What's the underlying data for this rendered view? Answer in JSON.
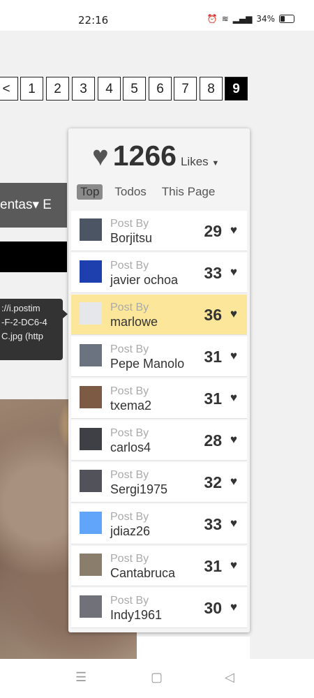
{
  "status_bar": {
    "time": "22:16",
    "battery": "34%"
  },
  "pagination": {
    "prev": "<",
    "pages": [
      "1",
      "2",
      "3",
      "4",
      "5",
      "6",
      "7",
      "8",
      "9"
    ],
    "current": "9"
  },
  "background": {
    "nav_text": "entas▾  E",
    "tooltip_lines": [
      "://i.postim",
      "-F-2-DC6-4",
      "C.jpg (http"
    ]
  },
  "likes_panel": {
    "total": "1266",
    "label": "Likes",
    "tabs": [
      "Top",
      "Todos",
      "This Page"
    ],
    "active_tab": "Top",
    "post_by_label": "Post By",
    "entries": [
      {
        "author": "Borjitsu",
        "score": "29",
        "avatar_color": "#4b5563"
      },
      {
        "author": "javier ochoa",
        "score": "33",
        "avatar_color": "#1e40af"
      },
      {
        "author": "marlowe",
        "score": "36",
        "avatar_color": "#e5e7eb",
        "highlight": true
      },
      {
        "author": "Pepe Manolo",
        "score": "31",
        "avatar_color": "#6b7280"
      },
      {
        "author": "txema2",
        "score": "31",
        "avatar_color": "#7c5a44"
      },
      {
        "author": "carlos4",
        "score": "28",
        "avatar_color": "#3f3f46"
      },
      {
        "author": "Sergi1975",
        "score": "32",
        "avatar_color": "#52525b"
      },
      {
        "author": "jdiaz26",
        "score": "33",
        "avatar_color": "#60a5fa"
      },
      {
        "author": "Cantabruca",
        "score": "31",
        "avatar_color": "#8b7d6b"
      },
      {
        "author": "Indy1961",
        "score": "30",
        "avatar_color": "#71717a"
      }
    ]
  },
  "nav_bar": {
    "menu_icon": "menu-icon",
    "home_icon": "home-icon",
    "back_icon": "back-icon"
  }
}
